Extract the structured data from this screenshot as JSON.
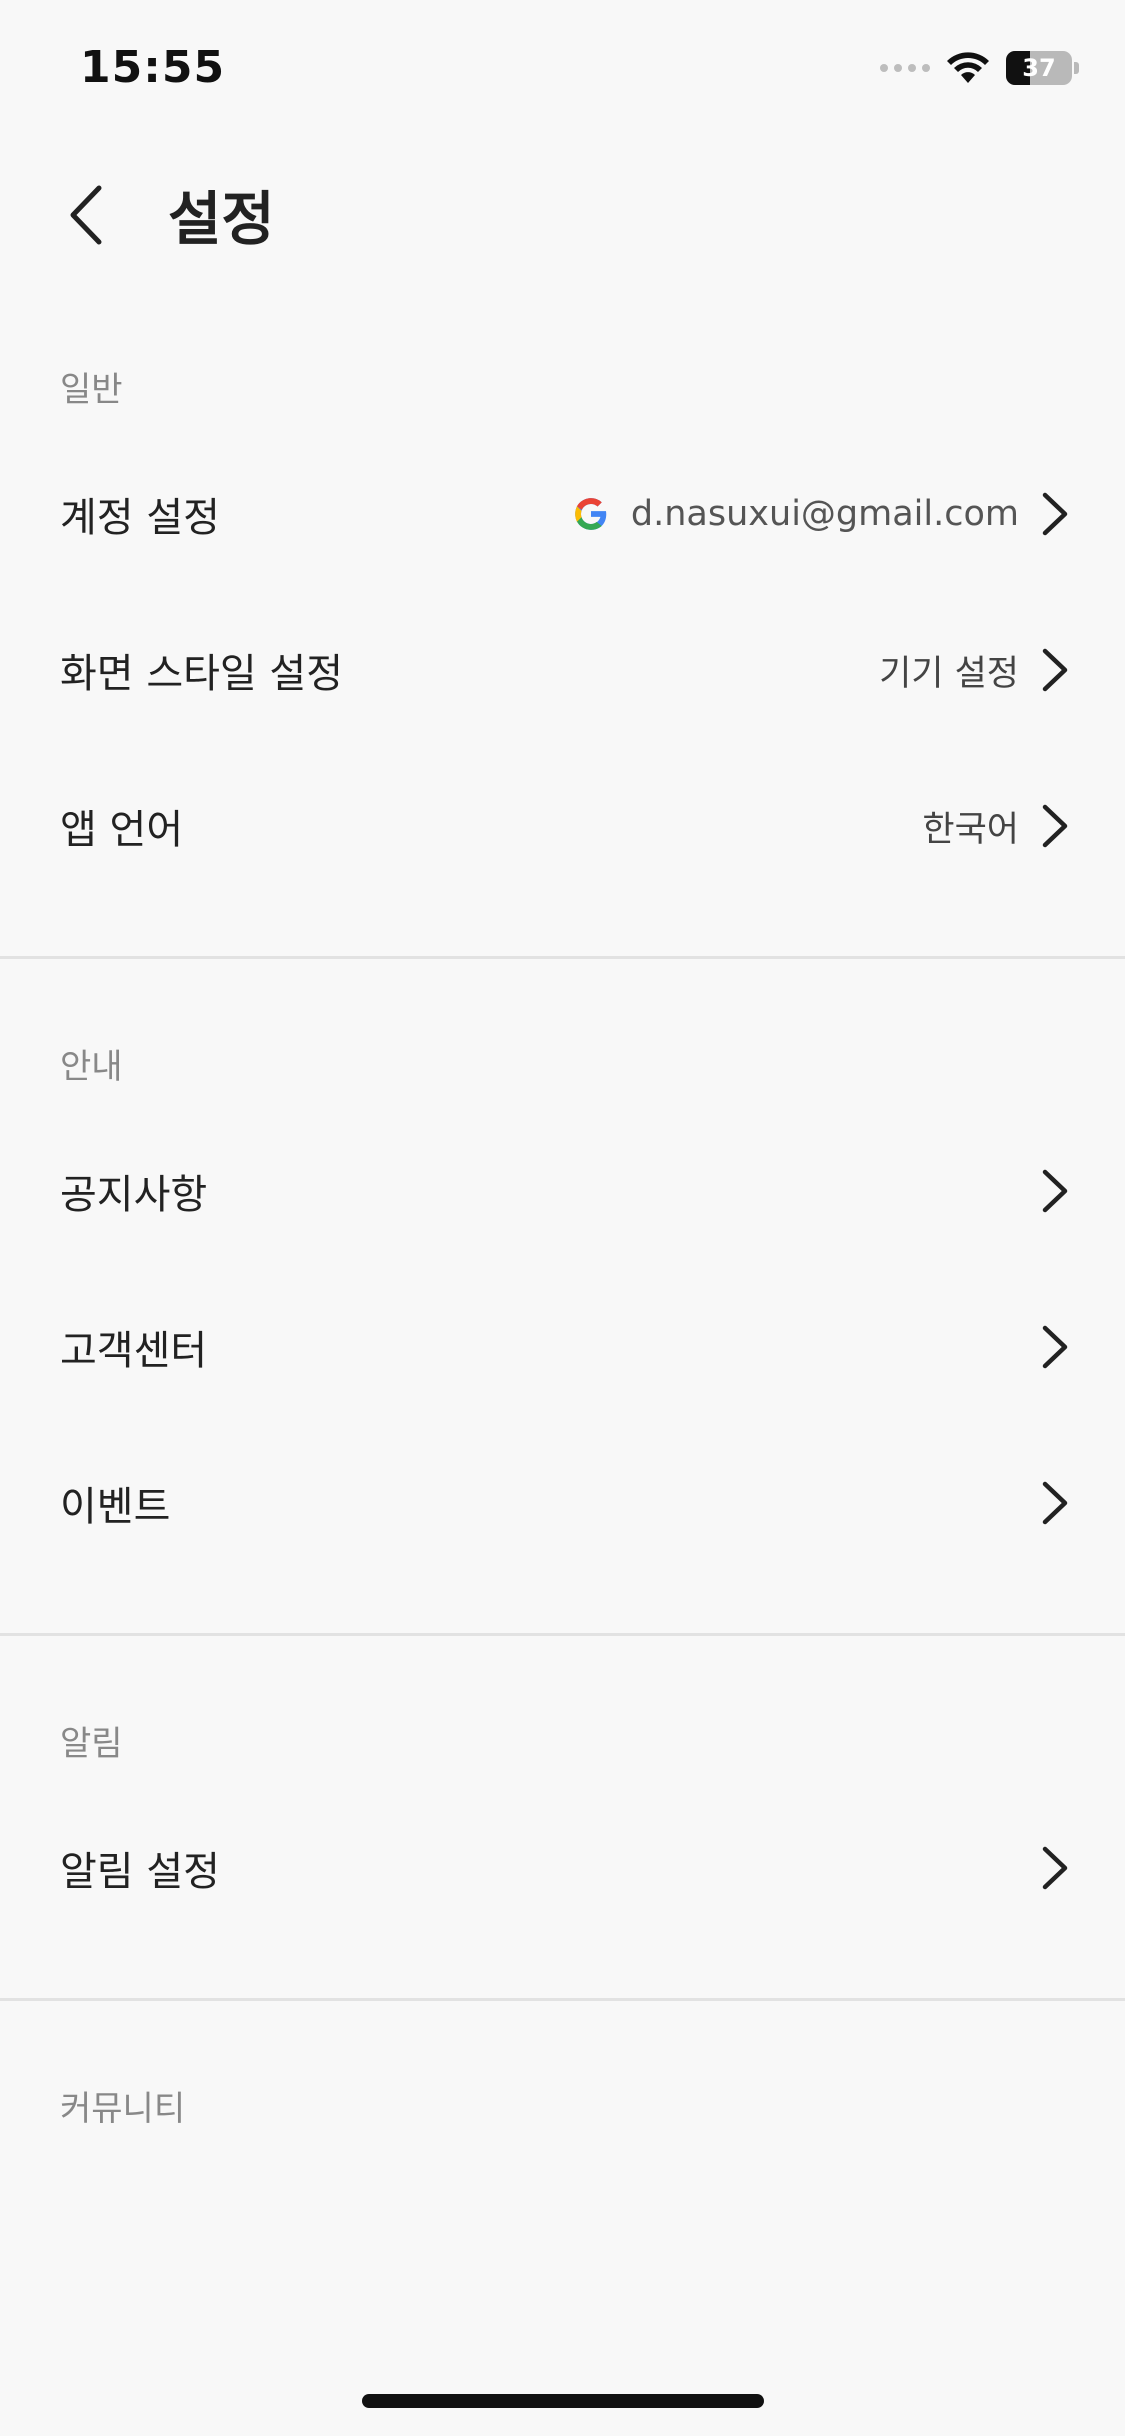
{
  "status_bar": {
    "time": "15:55",
    "battery_level": 37,
    "battery_label": "37",
    "wifi_icon": "wifi-icon",
    "signal_icon": "signal-dots-icon"
  },
  "header": {
    "title": "설정",
    "back_icon": "chevron-left-icon"
  },
  "sections": {
    "general": {
      "title": "일반",
      "account": {
        "label": "계정 설정",
        "provider_icon": "google-icon",
        "value": "d.nasuxui@gmail.com"
      },
      "display_style": {
        "label": "화면 스타일 설정",
        "value": "기기 설정"
      },
      "app_language": {
        "label": "앱 언어",
        "value": "한국어"
      }
    },
    "info": {
      "title": "안내",
      "notice": {
        "label": "공지사항"
      },
      "customer_center": {
        "label": "고객센터"
      },
      "event": {
        "label": "이벤트"
      }
    },
    "notifications": {
      "title": "알림",
      "notification_settings": {
        "label": "알림 설정"
      }
    },
    "community": {
      "title": "커뮤니티"
    }
  },
  "colors": {
    "background": "#f8f8f8",
    "text_primary": "#222222",
    "text_secondary": "#888888",
    "divider": "#e2e2e2"
  }
}
